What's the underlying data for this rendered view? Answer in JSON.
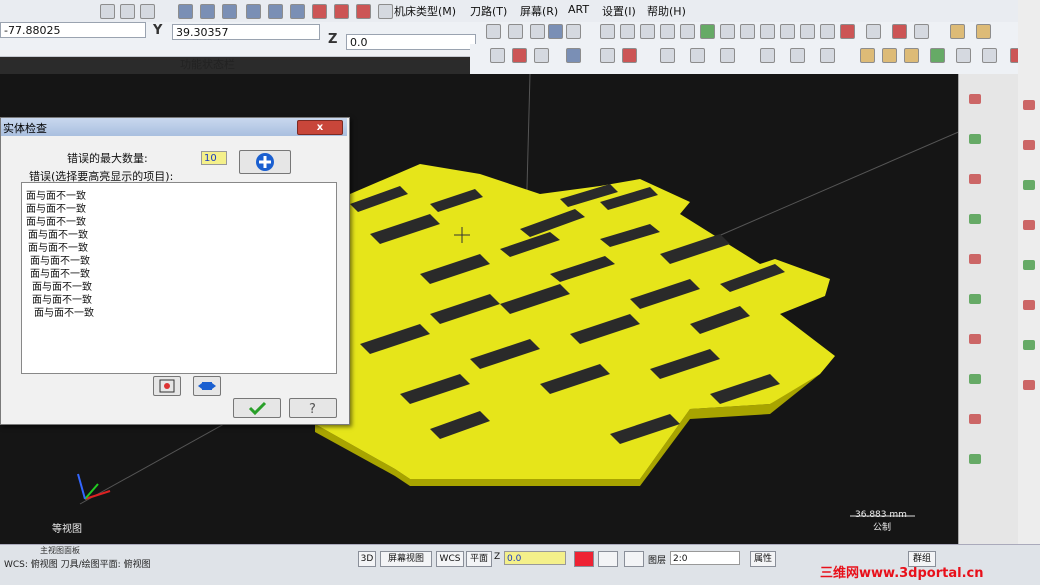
{
  "menubar": {
    "items": [
      "机床类型(M)",
      "刀路(T)",
      "屏幕(R)",
      "ART",
      "设置(I)",
      "帮助(H)"
    ]
  },
  "coords": {
    "x_value": "-77.88025",
    "y_label": "Y",
    "y_value": "39.30357",
    "z_label": "Z",
    "z_value": "0.0",
    "status_panel_label": "功能状态栏"
  },
  "dialog": {
    "title": "实体检查",
    "close_label": "x",
    "max_errors_label": "错误的最大数量:",
    "max_errors_value": "10",
    "errors_label": "错误(选择要高亮显示的项目):",
    "errors": [
      "面与面不一致",
      "面与面不一致",
      "面与面不一致",
      "面与面不一致",
      "面与面不一致",
      "面与面不一致",
      "面与面不一致",
      "面与面不一致",
      "面与面不一致",
      "面与面不一致"
    ],
    "ok_icon": "checkmark-icon",
    "help_icon": "help-icon"
  },
  "viewport": {
    "view_name": "等视图",
    "scale_value": "36.883 mm",
    "scale_unit": "公制",
    "part_color": "#e6e51a"
  },
  "statusbar": {
    "upper_text": "主视图面板",
    "wcs_text": "WCS: 俯视图  刀具/绘图平面: 俯视图",
    "btn_3d": "3D",
    "btn_screen_view": "屏幕视图",
    "btn_wcs": "WCS",
    "plane_label": "平面",
    "z_label": "Z",
    "z_value": "0.0",
    "layer_label": "图层",
    "layer_value": "2:0",
    "attr_label": "属性",
    "group_label": "群组"
  },
  "watermark": "三维网www.3dportal.cn"
}
